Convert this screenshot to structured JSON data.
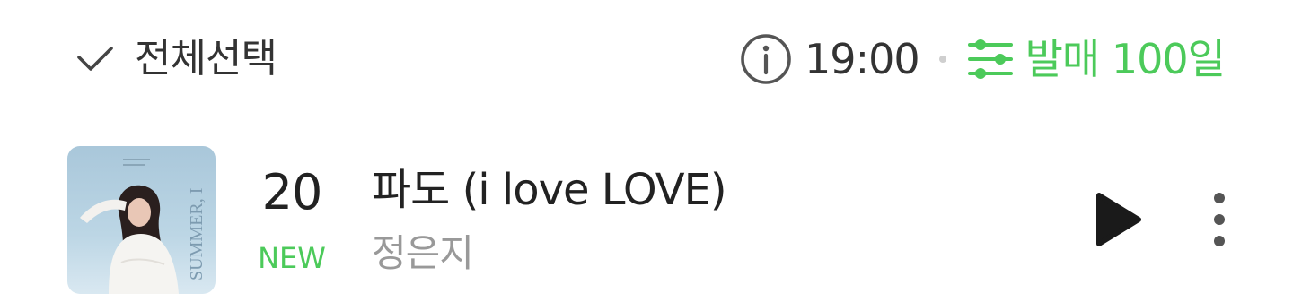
{
  "header": {
    "select_all_label": "전체선택",
    "check_icon": "check-icon",
    "info_icon": "info-icon",
    "time": "19:00",
    "filter_icon": "sliders-icon",
    "filter_label": "발매 100일"
  },
  "colors": {
    "accent_green": "#4cca5a",
    "text_primary": "#222222",
    "text_secondary": "#999999",
    "icon_gray": "#555555"
  },
  "chart_rows": [
    {
      "rank": "20",
      "rank_change": "NEW",
      "title": "파도 (i love LOVE)",
      "artist": "정은지",
      "album_art_text": "SUMMER, I",
      "play_icon": "play-icon",
      "more_icon": "more-vertical-icon"
    }
  ]
}
